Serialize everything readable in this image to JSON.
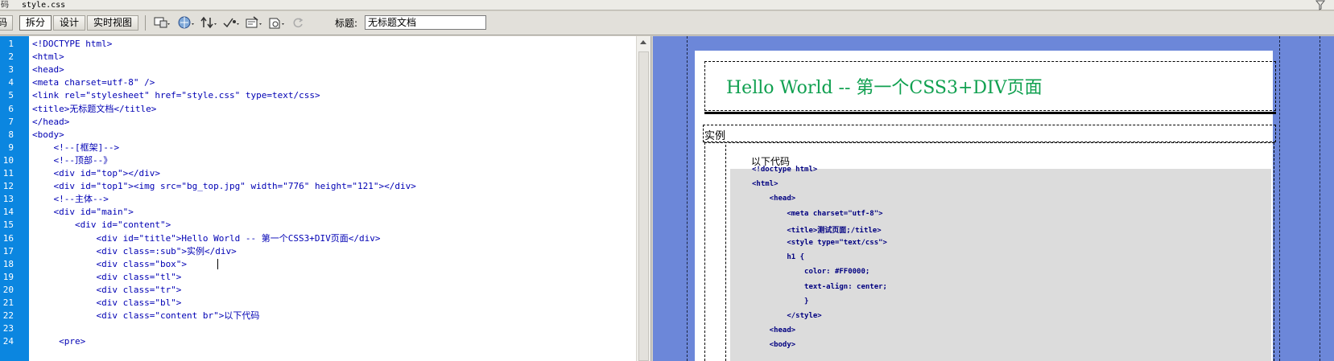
{
  "tab_strip": {
    "left_fragment": "码",
    "filename": "style.css"
  },
  "toolbar": {
    "view_buttons": [
      "码",
      "拆分",
      "设计",
      "实时视图"
    ],
    "active_view": "拆分",
    "title_label": "标题:",
    "title_value": "无标题文档",
    "icons": [
      "multiscreen-icon",
      "browser-preview-icon",
      "file-management-icon",
      "validate-icon",
      "visual-aids-icon",
      "check-browser-icon",
      "refresh-icon"
    ]
  },
  "code": {
    "lines": [
      {
        "n": "1",
        "text": "<!DOCTYPE html>"
      },
      {
        "n": "2",
        "text": "<html>"
      },
      {
        "n": "3",
        "text": "<head>"
      },
      {
        "n": "4",
        "text": "<meta charset=utf-8\" />"
      },
      {
        "n": "5",
        "text": "<link rel=\"stylesheet\" href=\"style.css\" type=text/css>"
      },
      {
        "n": "6",
        "text": "<title>无标题文档</title>"
      },
      {
        "n": "7",
        "text": "</head>"
      },
      {
        "n": "8",
        "text": "<body>"
      },
      {
        "n": "9",
        "text": "    <!--[框架]-->"
      },
      {
        "n": "10",
        "text": "    <!--顶部--》"
      },
      {
        "n": "11",
        "text": "    <div id=\"top\"></div>"
      },
      {
        "n": "12",
        "text": "    <div id=\"top1\"><img src=\"bg_top.jpg\" width=\"776\" height=\"121\"></div>"
      },
      {
        "n": "13",
        "text": "    <!--主体-->"
      },
      {
        "n": "14",
        "text": "    <div id=\"main\">"
      },
      {
        "n": "15",
        "text": "        <div id=\"content\">"
      },
      {
        "n": "16",
        "text": "            <div id=\"title\">Hello World -- 第一个CSS3+DIV页面</div>"
      },
      {
        "n": "17",
        "text": "            <div class=:sub\">实例</div>"
      },
      {
        "n": "18",
        "text": "            <div class=\"box\">"
      },
      {
        "n": "19",
        "text": "            <div class=\"tl\">"
      },
      {
        "n": "20",
        "text": "            <div class=\"tr\">"
      },
      {
        "n": "21",
        "text": "            <div class=\"bl\">"
      },
      {
        "n": "22",
        "text": "            <div class=\"content br\">以下代码"
      },
      {
        "n": "23",
        "text": ""
      },
      {
        "n": "24",
        "text": "     <pre>"
      }
    ]
  },
  "design": {
    "title": "Hello World -- 第一个CSS3+DIV页面",
    "sub": "实例",
    "content_label": "以下代码",
    "pre_lines": [
      "<!doctype html>",
      "<html>",
      "    <head>",
      "        <meta charset=\"utf-8\">",
      "        <title>测试页面;/title>",
      "        <style type=\"text/css\">",
      "        h1 {",
      "            color: #FF0000;",
      "            text-align: center;",
      "            }",
      "        </style>",
      "    <head>",
      "    <body>"
    ]
  },
  "colors": {
    "gutter": "#0b86e0",
    "code_text": "#0000b4",
    "design_background": "#6c87d9",
    "title_green": "#10a050",
    "pre_background": "#dcdcdc"
  }
}
